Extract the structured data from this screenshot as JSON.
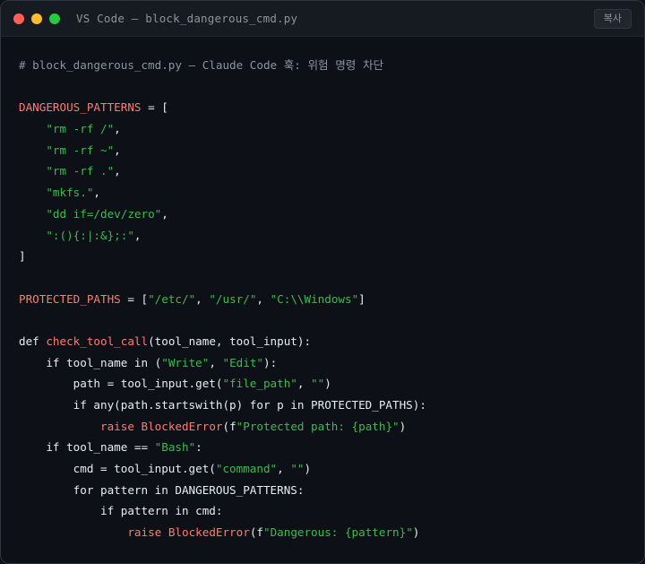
{
  "window": {
    "title": "VS Code — block_dangerous_cmd.py",
    "copy_label": "복사",
    "traffic_lights": [
      "#ff5f57",
      "#febc2e",
      "#28c840"
    ]
  },
  "theme": {
    "default": "#e6edf3",
    "comment": "#8b949e",
    "red": "#ff7b72",
    "string": "#3fb950",
    "funcname": "#ffa657",
    "keyword": "#e6edf3"
  },
  "code": {
    "lines": [
      [
        {
          "t": "# block_dangerous_cmd.py — Claude Code 훅: 위험 명령 차단",
          "k": "comment"
        }
      ],
      [],
      [
        {
          "t": "DANGEROUS_PATTERNS",
          "k": "red"
        },
        {
          "t": " = [",
          "k": "default"
        }
      ],
      [
        {
          "t": "    ",
          "k": "default"
        },
        {
          "t": "\"rm -rf /\"",
          "k": "string"
        },
        {
          "t": ",",
          "k": "default"
        }
      ],
      [
        {
          "t": "    ",
          "k": "default"
        },
        {
          "t": "\"rm -rf ~\"",
          "k": "string"
        },
        {
          "t": ",",
          "k": "default"
        }
      ],
      [
        {
          "t": "    ",
          "k": "default"
        },
        {
          "t": "\"rm -rf .\"",
          "k": "string"
        },
        {
          "t": ",",
          "k": "default"
        }
      ],
      [
        {
          "t": "    ",
          "k": "default"
        },
        {
          "t": "\"mkfs.\"",
          "k": "string"
        },
        {
          "t": ",",
          "k": "default"
        }
      ],
      [
        {
          "t": "    ",
          "k": "default"
        },
        {
          "t": "\"dd if=/dev/zero\"",
          "k": "string"
        },
        {
          "t": ",",
          "k": "default"
        }
      ],
      [
        {
          "t": "    ",
          "k": "default"
        },
        {
          "t": "\":(){:|:&};:\"",
          "k": "string"
        },
        {
          "t": ",",
          "k": "default"
        }
      ],
      [
        {
          "t": "]",
          "k": "default"
        }
      ],
      [],
      [
        {
          "t": "PROTECTED_PATHS",
          "k": "red"
        },
        {
          "t": " = [",
          "k": "default"
        },
        {
          "t": "\"/etc/\"",
          "k": "string"
        },
        {
          "t": ", ",
          "k": "default"
        },
        {
          "t": "\"/usr/\"",
          "k": "string"
        },
        {
          "t": ", ",
          "k": "default"
        },
        {
          "t": "\"C:\\\\Windows\"",
          "k": "string"
        },
        {
          "t": "]",
          "k": "default"
        }
      ],
      [],
      [
        {
          "t": "def ",
          "k": "default"
        },
        {
          "t": "check_tool_call",
          "k": "red"
        },
        {
          "t": "(tool_name, tool_input):",
          "k": "default"
        }
      ],
      [
        {
          "t": "    if tool_name in (",
          "k": "default"
        },
        {
          "t": "\"Write\"",
          "k": "string"
        },
        {
          "t": ", ",
          "k": "default"
        },
        {
          "t": "\"Edit\"",
          "k": "string"
        },
        {
          "t": "):",
          "k": "default"
        }
      ],
      [
        {
          "t": "        path = tool_input.get(",
          "k": "default"
        },
        {
          "t": "\"file_path\"",
          "k": "string"
        },
        {
          "t": ", ",
          "k": "default"
        },
        {
          "t": "\"\"",
          "k": "string"
        },
        {
          "t": ")",
          "k": "default"
        }
      ],
      [
        {
          "t": "        if any(path.startswith(p) for p in PROTECTED_PATHS):",
          "k": "default"
        }
      ],
      [
        {
          "t": "            ",
          "k": "default"
        },
        {
          "t": "raise BlockedError",
          "k": "red"
        },
        {
          "t": "(f",
          "k": "default"
        },
        {
          "t": "\"Protected path: {path}\"",
          "k": "string"
        },
        {
          "t": ")",
          "k": "default"
        }
      ],
      [
        {
          "t": "    if tool_name == ",
          "k": "default"
        },
        {
          "t": "\"Bash\"",
          "k": "string"
        },
        {
          "t": ":",
          "k": "default"
        }
      ],
      [
        {
          "t": "        cmd = tool_input.get(",
          "k": "default"
        },
        {
          "t": "\"command\"",
          "k": "string"
        },
        {
          "t": ", ",
          "k": "default"
        },
        {
          "t": "\"\"",
          "k": "string"
        },
        {
          "t": ")",
          "k": "default"
        }
      ],
      [
        {
          "t": "        for pattern in DANGEROUS_PATTERNS:",
          "k": "default"
        }
      ],
      [
        {
          "t": "            if pattern in cmd:",
          "k": "default"
        }
      ],
      [
        {
          "t": "                ",
          "k": "default"
        },
        {
          "t": "raise BlockedError",
          "k": "red"
        },
        {
          "t": "(f",
          "k": "default"
        },
        {
          "t": "\"Dangerous: {pattern}\"",
          "k": "string"
        },
        {
          "t": ")",
          "k": "default"
        }
      ]
    ]
  }
}
